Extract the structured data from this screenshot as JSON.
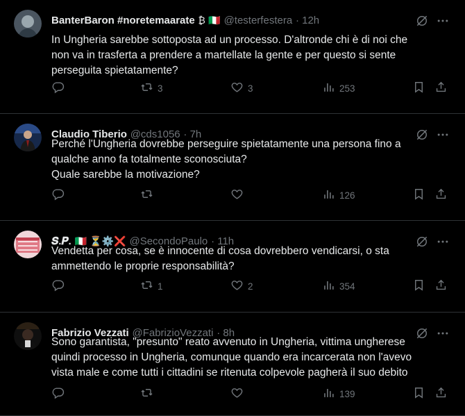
{
  "tweets": [
    {
      "name": "BanterBaron #noretemaarate",
      "badges": "₿ 🇮🇹",
      "handle": "@testerfestera",
      "time": "· 12h",
      "text": "In Ungheria sarebbe sottoposta ad un processo. D'altronde chi è di noi che\nnon va in trasferta a prendere a martellate la gente e per questo si sente\nperseguita spietatamente?",
      "reposts": "3",
      "likes": "3",
      "views": "253"
    },
    {
      "name": "Claudio Tiberio",
      "badges": "",
      "handle": "@cds1056",
      "time": "· 7h",
      "text": "Perché l'Ungheria dovrebbe perseguire spietatamente una persona fino a\nqualche anno fa totalmente sconosciuta?\nQuale sarebbe la motivazione?",
      "reposts": "",
      "likes": "",
      "views": "126"
    },
    {
      "name": "𝑺.𝑷.",
      "badges": "🇮🇹 ⏳⚙️❌",
      "handle": "@SecondoPaulo",
      "time": "· 11h",
      "text": "Vendetta per cosa, se è innocente di cosa dovrebbero vendicarsi, o sta\nammettendo le proprie responsabilità?",
      "reposts": "1",
      "likes": "2",
      "views": "354"
    },
    {
      "name": "Fabrizio Vezzati",
      "badges": "",
      "handle": "@FabrizioVezzati",
      "time": "· 8h",
      "text": "Sono garantista, \"presunto\" reato avvenuto in Ungheria, vittima ungherese\nquindi processo in Ungheria, comunque quando era incarcerata non l'avevo\nvista male e come tutti i cittadini se ritenuta colpevole pagherà il suo debito",
      "reposts": "",
      "likes": "",
      "views": "139"
    }
  ],
  "icons": {
    "reply": "reply-icon",
    "repost": "repost-icon",
    "like": "like-icon",
    "views": "views-icon",
    "bookmark": "bookmark-icon",
    "share": "share-icon",
    "grok": "grok-icon",
    "more": "more-icon"
  },
  "colors": {
    "background": "#000000",
    "text": "#e7e9ea",
    "muted": "#71767b",
    "divider": "#2f3336"
  }
}
